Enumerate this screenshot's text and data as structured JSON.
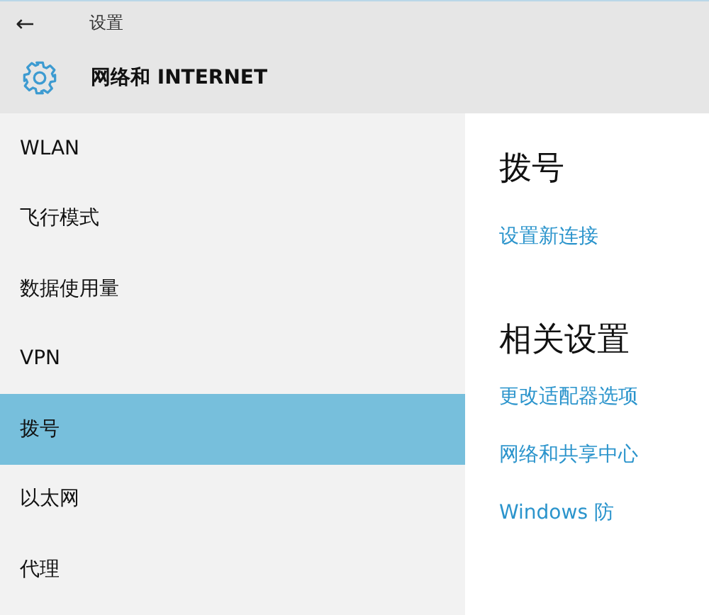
{
  "window": {
    "back": "←",
    "title": "设置"
  },
  "header": {
    "title": "网络和 INTERNET"
  },
  "sidebar": {
    "items": [
      {
        "label": "WLAN",
        "selected": false
      },
      {
        "label": "飞行模式",
        "selected": false
      },
      {
        "label": "数据使用量",
        "selected": false
      },
      {
        "label": "VPN",
        "selected": false
      },
      {
        "label": "拨号",
        "selected": true
      },
      {
        "label": "以太网",
        "selected": false
      },
      {
        "label": "代理",
        "selected": false
      }
    ]
  },
  "content": {
    "sections": [
      {
        "heading": "拨号",
        "links": [
          "设置新连接"
        ]
      },
      {
        "heading": "相关设置",
        "links": [
          "更改适配器选项",
          "网络和共享中心",
          "Windows 防"
        ]
      }
    ]
  }
}
